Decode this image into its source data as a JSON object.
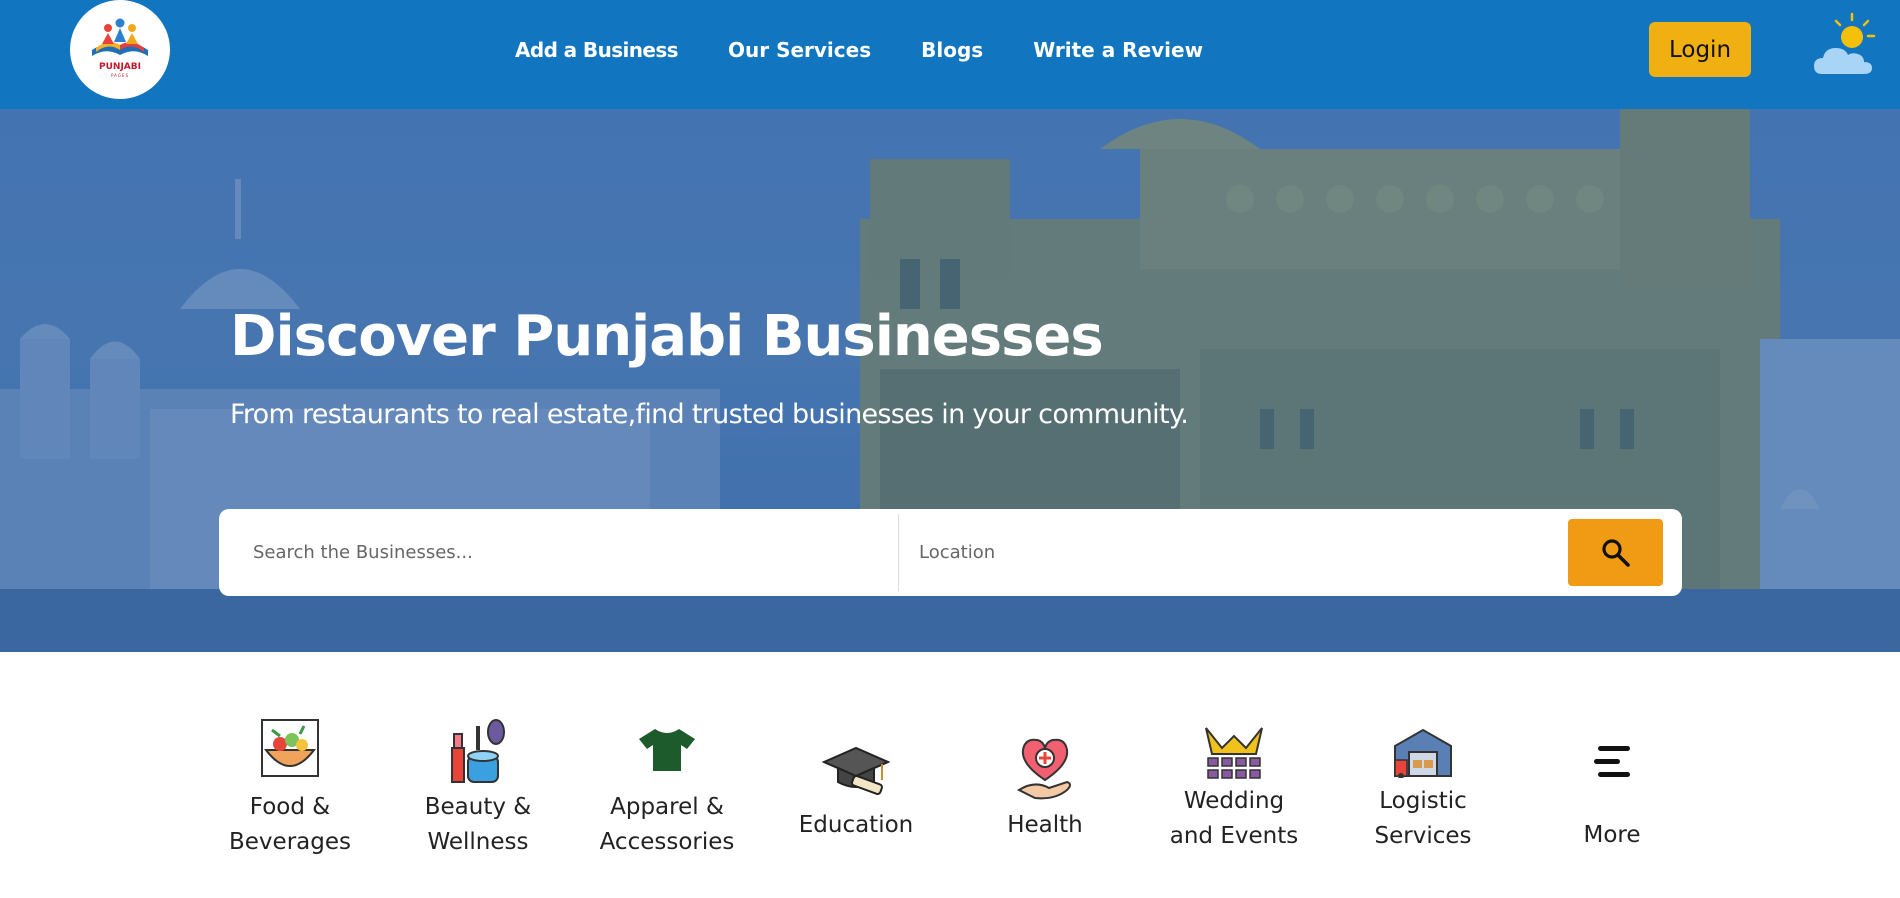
{
  "header": {
    "logo_text": "PUNJABI",
    "logo_subtext": "PAGES",
    "nav": [
      "Add a Business",
      "Our Services",
      "Blogs",
      "Write a Review"
    ],
    "login_label": "Login"
  },
  "hero": {
    "title": "Discover Punjabi Businesses",
    "subtitle": "From restaurants to real estate,find trusted businesses in your community.",
    "search_placeholder": "Search the Businesses...",
    "location_placeholder": "Location"
  },
  "categories": [
    {
      "label": "Food &\nBeverages",
      "icon": "food-bowl-icon"
    },
    {
      "label": "Beauty &\nWellness",
      "icon": "cosmetics-icon"
    },
    {
      "label": "Apparel &\nAccessories",
      "icon": "tshirt-icon"
    },
    {
      "label": "Education",
      "icon": "graduation-cap-icon"
    },
    {
      "label": "Health",
      "icon": "health-heart-icon"
    },
    {
      "label": "Wedding\nand Events",
      "icon": "wedding-icon"
    },
    {
      "label": "Logistic\nServices",
      "icon": "warehouse-truck-icon"
    },
    {
      "label": "More",
      "icon": "menu-icon"
    }
  ],
  "colors": {
    "header_bg": "#1175bf",
    "login_bg": "#f0b011",
    "search_button_bg": "#f19b14"
  }
}
